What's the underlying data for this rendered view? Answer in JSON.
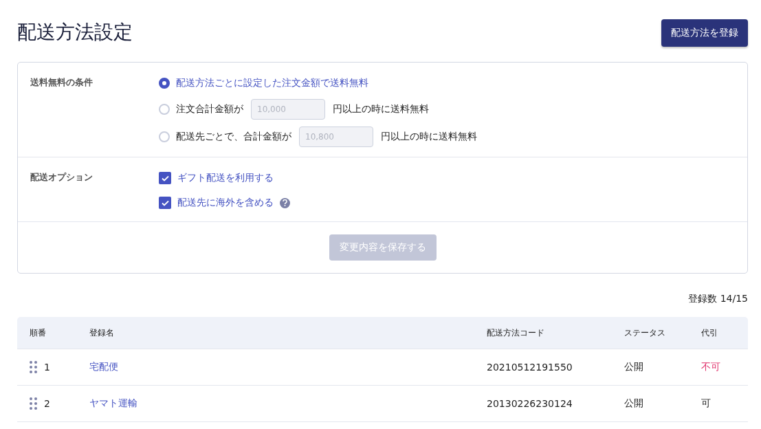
{
  "title": "配送方法設定",
  "register_button": "配送方法を登録",
  "free_shipping": {
    "label": "送料無料の条件",
    "options": [
      {
        "kind": "plain",
        "selected": true,
        "label": "配送方法ごとに設定した注文金額で送料無料"
      },
      {
        "kind": "amount",
        "selected": false,
        "label": "注文合計金額が",
        "placeholder": "10,000",
        "suffix": "円以上の時に送料無料"
      },
      {
        "kind": "amount",
        "selected": false,
        "label": "配送先ごとで、合計金額が",
        "placeholder": "10,800",
        "suffix": "円以上の時に送料無料"
      }
    ]
  },
  "shipping_options": {
    "label": "配送オプション",
    "items": [
      {
        "label": "ギフト配送を利用する",
        "checked": true,
        "help": false
      },
      {
        "label": "配送先に海外を含める",
        "checked": true,
        "help": true
      }
    ]
  },
  "save_button": {
    "label": "変更内容を保存する",
    "disabled": true
  },
  "count": "登録数 14/15",
  "table": {
    "columns": [
      "順番",
      "登録名",
      "配送方法コード",
      "ステータス",
      "代引"
    ],
    "rows": [
      {
        "order": "1",
        "name": "宅配便",
        "code": "20210512191550",
        "status": "公開",
        "cod": "不可",
        "cod_warning": true
      },
      {
        "order": "2",
        "name": "ヤマト運輸",
        "code": "20130226230124",
        "status": "公開",
        "cod": "可",
        "cod_warning": false
      }
    ]
  }
}
